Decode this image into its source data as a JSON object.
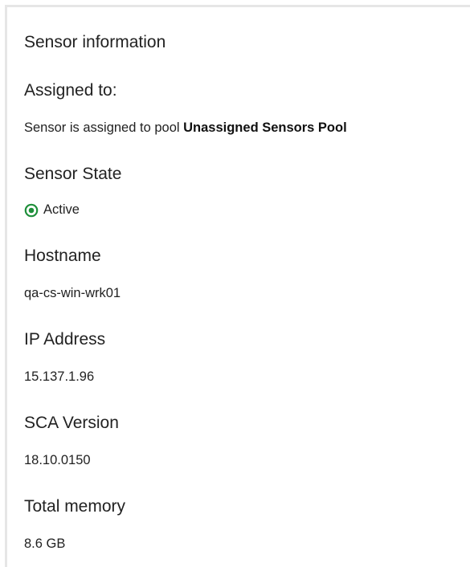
{
  "panel": {
    "title": "Sensor information",
    "assigned": {
      "label": "Assigned to:",
      "prefix": "Sensor is assigned to pool ",
      "pool": "Unassigned Sensors Pool"
    },
    "state": {
      "label": "Sensor State",
      "value": "Active",
      "icon": "active-status-icon",
      "color": "#1e8f3a"
    },
    "hostname": {
      "label": "Hostname",
      "value": "qa-cs-win-wrk01"
    },
    "ip": {
      "label": "IP Address",
      "value": "15.137.1.96"
    },
    "sca": {
      "label": "SCA Version",
      "value": "18.10.0150"
    },
    "memory": {
      "label": "Total memory",
      "value": "8.6 GB"
    }
  }
}
